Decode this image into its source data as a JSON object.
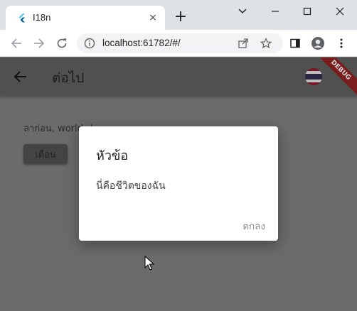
{
  "browser": {
    "tab_title": "I18n",
    "tab_close": "×",
    "new_tab": "+",
    "url": "localhost:61782/#/"
  },
  "app": {
    "title": "ต่อไป",
    "body_text": "ลาก่อน, world :/",
    "warn_button_label": "เตือน",
    "debug_banner": "DEBUG"
  },
  "dialog": {
    "title": "หัวข้อ",
    "content": "นี่คือชีวิตของฉัน",
    "ok_label": "ตกลง"
  },
  "colors": {
    "scrim": "#6b6b6b",
    "appbar": "#505050",
    "debug": "#7a1c1c",
    "flag_red": "#a51931",
    "flag_white": "#f4f5f8",
    "flag_blue": "#2d2a4a"
  },
  "icons": {
    "back": "arrow-left",
    "reload": "reload",
    "info": "info-circle",
    "share": "share",
    "bookmark": "star",
    "sidebar": "side-panel",
    "profile": "avatar",
    "menu": "kebab"
  }
}
